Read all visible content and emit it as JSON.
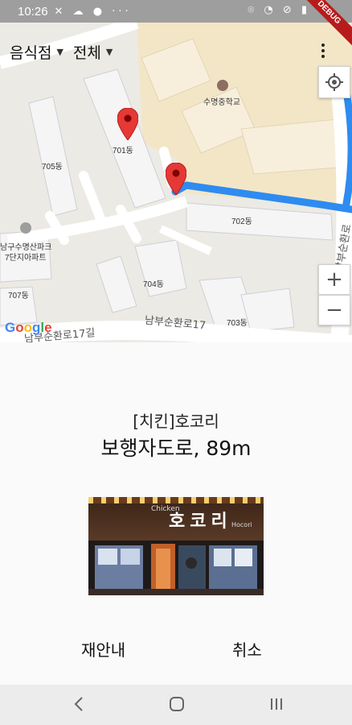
{
  "status_bar": {
    "time": "10:26",
    "left_icons_text": "···",
    "debug_ribbon": "DEBUG"
  },
  "map": {
    "category_dropdown": "음식점",
    "filter_dropdown": "전체",
    "labels": {
      "school": "수명중학교",
      "b701": "701동",
      "b705": "705동",
      "b702": "702동",
      "b704": "704동",
      "b707": "707동",
      "b703": "703동",
      "apartment_line1": "남구수명산파크",
      "apartment_line2": "7단지아파트",
      "road_bottom1": "남부순환로17길",
      "road_bottom2": "남부순환로17",
      "road_right": "남부순환로"
    },
    "google_logo": [
      "G",
      "o",
      "o",
      "g",
      "l",
      "e"
    ],
    "google_colors": [
      "#4285F4",
      "#EA4335",
      "#FBBC05",
      "#4285F4",
      "#34A853",
      "#EA4335"
    ],
    "route_color": "#2e8bf0",
    "marker_color": "#e53935"
  },
  "info": {
    "place_name": "[치킨]호코리",
    "route_summary": "보행자도로, 89m",
    "photo_sign": "호코리",
    "photo_sign_small": "Chicken",
    "photo_sign_small2": "Hocori"
  },
  "actions": {
    "reroute": "재안내",
    "cancel": "취소"
  },
  "icons": {
    "more": "more-vert-icon",
    "my_location": "my-location-icon",
    "zoom_in": "plus-icon",
    "zoom_out": "minus-icon",
    "nav_back": "back-icon",
    "nav_home": "home-icon",
    "nav_recent": "recent-apps-icon"
  },
  "zoom_in_symbol": "+",
  "zoom_out_symbol": "−"
}
